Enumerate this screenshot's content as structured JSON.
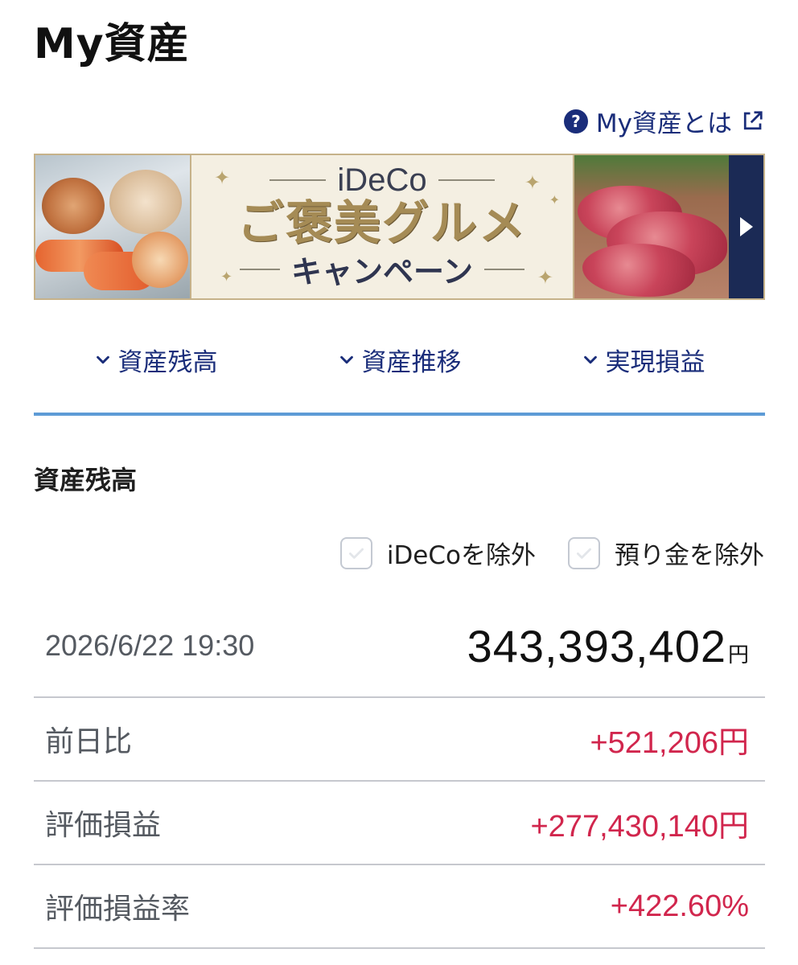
{
  "page": {
    "title": "My資産"
  },
  "help": {
    "label": "My資産とは",
    "icon": "question-circle-icon",
    "external_icon": "external-link-icon"
  },
  "banner": {
    "top": "iDeCo",
    "main": "ご褒美グルメ",
    "sub": "キャンペーン",
    "left_image": "crab-platter-image",
    "right_image": "wagyu-beef-image",
    "arrow_icon": "play-arrow-icon"
  },
  "anchor_nav": {
    "items": [
      {
        "label": "資産残高",
        "icon": "chevron-down-icon"
      },
      {
        "label": "資産推移",
        "icon": "chevron-down-icon"
      },
      {
        "label": "実現損益",
        "icon": "chevron-down-icon"
      }
    ]
  },
  "section": {
    "title": "資産残高"
  },
  "filters": {
    "exclude_ideco": {
      "label": "iDeCoを除外",
      "checked": false
    },
    "exclude_deposit": {
      "label": "預り金を除外",
      "checked": false
    }
  },
  "summary": {
    "datetime": "2026/6/22 19:30",
    "total": "343,393,402",
    "total_unit": "円",
    "rows": [
      {
        "label": "前日比",
        "value": "+521,206円"
      },
      {
        "label": "評価損益",
        "value": "+277,430,140円"
      },
      {
        "label": "評価損益率",
        "value": "+422.60%"
      }
    ]
  },
  "colors": {
    "accent_navy": "#1a2d7a",
    "positive_red": "#d1264d",
    "rule_blue": "#5d9bd6"
  }
}
